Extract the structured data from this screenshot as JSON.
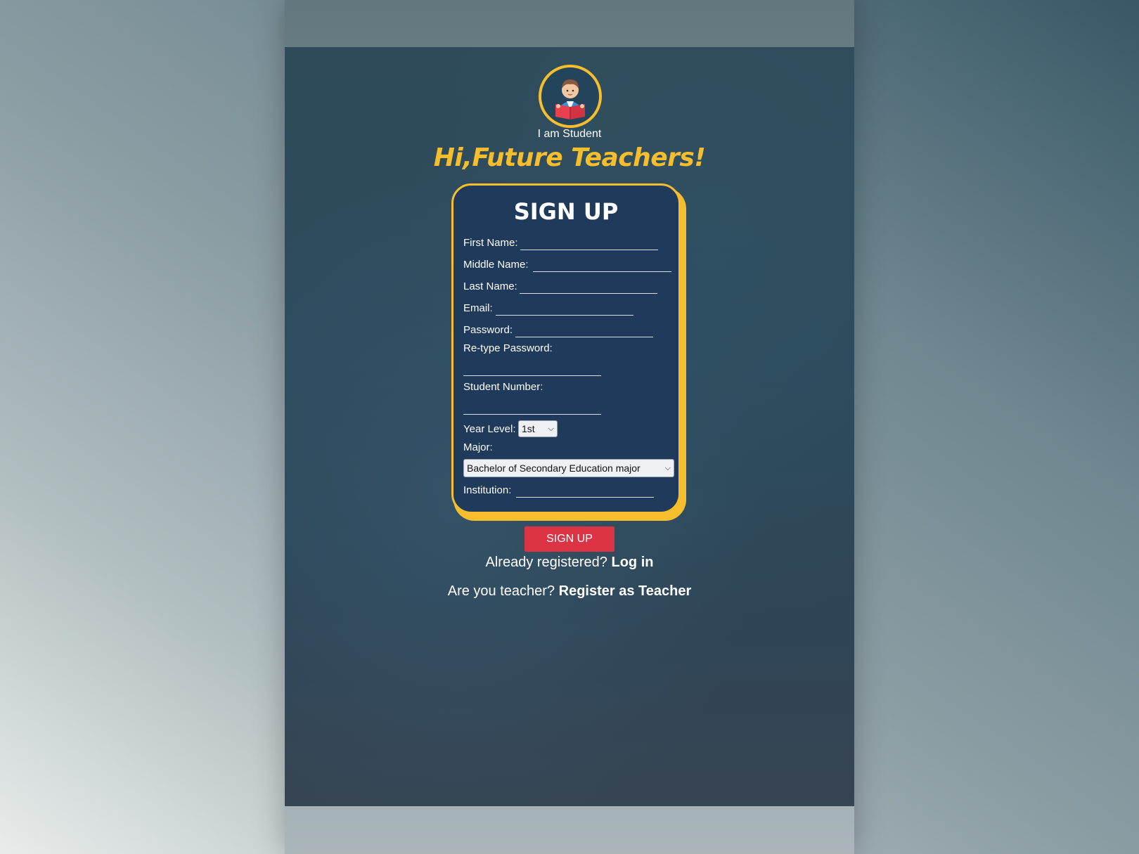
{
  "header": {
    "role_label": "I am Student",
    "greeting": "Hi,Future Teachers!",
    "avatar_icon": "student-reading-book-icon"
  },
  "form": {
    "title": "SIGN UP",
    "first_name_label": "First Name:",
    "middle_name_label": "Middle Name:",
    "last_name_label": "Last Name:",
    "email_label": "Email:",
    "password_label": "Password:",
    "retype_password_label": "Re-type Password:",
    "student_number_label": "Student Number:",
    "year_level_label": "Year Level:",
    "year_level_value": "1st",
    "major_label": "Major:",
    "major_value": "Bachelor of Secondary Education major",
    "institution_label": "Institution:",
    "submit_label": "SIGN UP"
  },
  "footer": {
    "login_prompt": "Already registered?",
    "login_link": "Log in",
    "teacher_prompt": "Are you teacher?",
    "teacher_link": "Register as Teacher"
  },
  "colors": {
    "accent_yellow": "#f6bd2c",
    "card_bg": "#1f3a5a",
    "button_red": "#dd3445"
  }
}
